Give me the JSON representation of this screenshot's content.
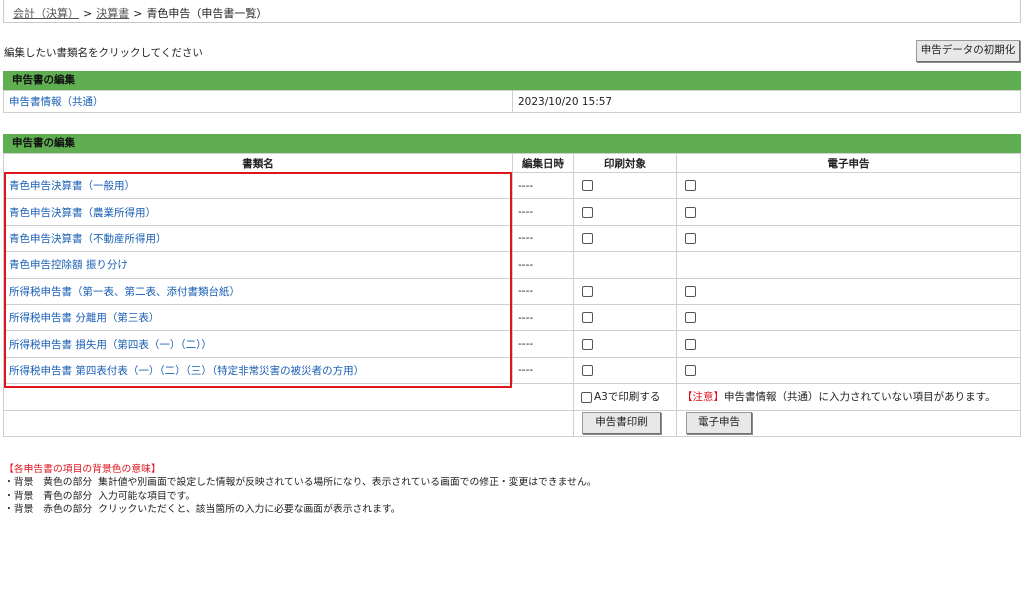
{
  "breadcrumb": {
    "items": [
      "会計（決算）",
      "決算書"
    ],
    "separator": ">",
    "current": "青色申告（申告書一覧）"
  },
  "instruction": "編集したい書類名をクリックしてください",
  "init_button": "申告データの初期化",
  "section1": {
    "title": "申告書の編集",
    "row": {
      "name": "申告書情報（共通）",
      "datetime": "2023/10/20 15:57"
    }
  },
  "section2": {
    "title": "申告書の編集",
    "headers": {
      "name": "書類名",
      "edited": "編集日時",
      "print": "印刷対象",
      "efile": "電子申告"
    },
    "rows": [
      {
        "name": "青色申告決算書（一般用）",
        "edited": "----"
      },
      {
        "name": "青色申告決算書（農業所得用）",
        "edited": "----"
      },
      {
        "name": "青色申告決算書（不動産所得用）",
        "edited": "----"
      },
      {
        "name": "青色申告控除額 振り分け",
        "edited": "----"
      },
      {
        "name": "所得税申告書（第一表、第二表、添付書類台紙）",
        "edited": "----"
      },
      {
        "name": "所得税申告書 分離用（第三表）",
        "edited": "----"
      },
      {
        "name": "所得税申告書 損失用（第四表（一）（二））",
        "edited": "----"
      },
      {
        "name": "所得税申告書 第四表付表（一）（二）（三）（特定非常災害の被災者の方用）",
        "edited": "----"
      }
    ],
    "a3_label": "A3で印刷する",
    "notice_tag": "【注意】",
    "notice_text": "申告書情報（共通）に入力されていない項目があります。",
    "print_button": "申告書印刷",
    "efile_button": "電子申告"
  },
  "legend": {
    "title": "【各申告書の項目の背景色の意味】",
    "lines": [
      {
        "label": "・背景　黄色の部分",
        "desc": "集計値や別画面で設定した情報が反映されている場所になり、表示されている画面での修正・変更はできません。"
      },
      {
        "label": "・背景　青色の部分",
        "desc": "入力可能な項目です。"
      },
      {
        "label": "・背景　赤色の部分",
        "desc": "クリックいただくと、該当箇所の入力に必要な画面が表示されます。"
      }
    ]
  },
  "colors": {
    "section_header": "#5fae51",
    "link": "#1a5fb4",
    "highlight_box": "#e0141e"
  }
}
